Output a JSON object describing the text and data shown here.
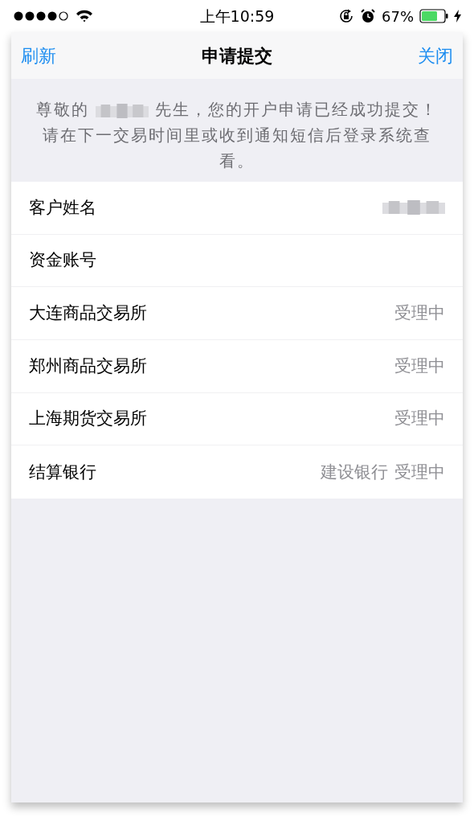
{
  "status_bar": {
    "time": "上午10:59",
    "battery": "67%"
  },
  "nav_bar": {
    "left": "刷新",
    "title": "申请提交",
    "right": "关闭"
  },
  "message": {
    "before": "尊敬的",
    "after": "先生，您的开户申请已经成功提交！请在下一交易时间里或收到通知短信后登录系统查看。",
    "redacted": true
  },
  "rows": [
    {
      "label": "客户姓名",
      "values": [],
      "redacted": true
    },
    {
      "label": "资金账号",
      "values": [],
      "redacted": false
    },
    {
      "label": "大连商品交易所",
      "values": [
        "受理中"
      ],
      "redacted": false
    },
    {
      "label": "郑州商品交易所",
      "values": [
        "受理中"
      ],
      "redacted": false
    },
    {
      "label": "上海期货交易所",
      "values": [
        "受理中"
      ],
      "redacted": false
    },
    {
      "label": "结算银行",
      "values": [
        "建设银行",
        "受理中"
      ],
      "redacted": false
    }
  ]
}
